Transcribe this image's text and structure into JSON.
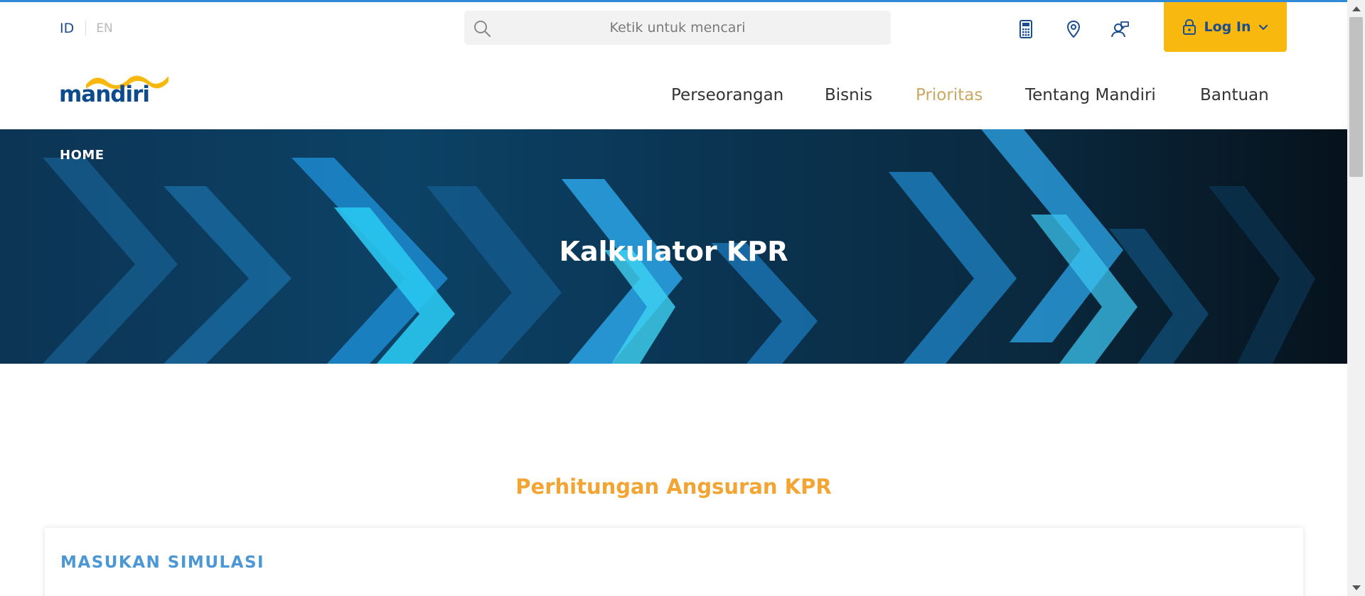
{
  "header": {
    "languages": {
      "active": "ID",
      "inactive": "EN"
    },
    "search": {
      "placeholder": "Ketik untuk mencari"
    },
    "icons": [
      "calculator-icon",
      "location-pin-icon",
      "customer-support-icon"
    ],
    "login": {
      "label": "Log In"
    },
    "logo": {
      "text": "mandiri"
    },
    "nav": [
      {
        "label": "Perseorangan",
        "active": false
      },
      {
        "label": "Bisnis",
        "active": false
      },
      {
        "label": "Prioritas",
        "active": true
      },
      {
        "label": "Tentang Mandiri",
        "active": false
      },
      {
        "label": "Bantuan",
        "active": false
      }
    ]
  },
  "hero": {
    "breadcrumb": "HOME",
    "title": "Kalkulator KPR"
  },
  "main": {
    "section_title": "Perhitungan Angsuran KPR",
    "card_title": "MASUKAN SIMULASI"
  },
  "colors": {
    "brand_blue": "#0d4b8d",
    "brand_gold": "#f8b80e",
    "nav_active": "#c9a961",
    "section_title": "#f2a533",
    "card_title": "#4c97d6"
  }
}
